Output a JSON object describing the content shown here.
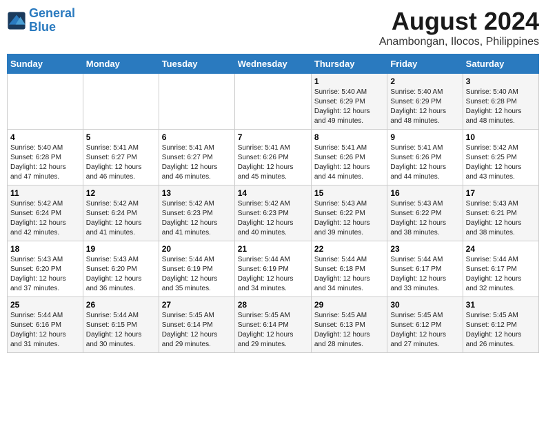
{
  "header": {
    "logo_line1": "General",
    "logo_line2": "Blue",
    "title": "August 2024",
    "subtitle": "Anambongan, Ilocos, Philippines"
  },
  "days_of_week": [
    "Sunday",
    "Monday",
    "Tuesday",
    "Wednesday",
    "Thursday",
    "Friday",
    "Saturday"
  ],
  "weeks": [
    [
      {
        "day": "",
        "info": ""
      },
      {
        "day": "",
        "info": ""
      },
      {
        "day": "",
        "info": ""
      },
      {
        "day": "",
        "info": ""
      },
      {
        "day": "1",
        "info": "Sunrise: 5:40 AM\nSunset: 6:29 PM\nDaylight: 12 hours\nand 49 minutes."
      },
      {
        "day": "2",
        "info": "Sunrise: 5:40 AM\nSunset: 6:29 PM\nDaylight: 12 hours\nand 48 minutes."
      },
      {
        "day": "3",
        "info": "Sunrise: 5:40 AM\nSunset: 6:28 PM\nDaylight: 12 hours\nand 48 minutes."
      }
    ],
    [
      {
        "day": "4",
        "info": "Sunrise: 5:40 AM\nSunset: 6:28 PM\nDaylight: 12 hours\nand 47 minutes."
      },
      {
        "day": "5",
        "info": "Sunrise: 5:41 AM\nSunset: 6:27 PM\nDaylight: 12 hours\nand 46 minutes."
      },
      {
        "day": "6",
        "info": "Sunrise: 5:41 AM\nSunset: 6:27 PM\nDaylight: 12 hours\nand 46 minutes."
      },
      {
        "day": "7",
        "info": "Sunrise: 5:41 AM\nSunset: 6:26 PM\nDaylight: 12 hours\nand 45 minutes."
      },
      {
        "day": "8",
        "info": "Sunrise: 5:41 AM\nSunset: 6:26 PM\nDaylight: 12 hours\nand 44 minutes."
      },
      {
        "day": "9",
        "info": "Sunrise: 5:41 AM\nSunset: 6:26 PM\nDaylight: 12 hours\nand 44 minutes."
      },
      {
        "day": "10",
        "info": "Sunrise: 5:42 AM\nSunset: 6:25 PM\nDaylight: 12 hours\nand 43 minutes."
      }
    ],
    [
      {
        "day": "11",
        "info": "Sunrise: 5:42 AM\nSunset: 6:24 PM\nDaylight: 12 hours\nand 42 minutes."
      },
      {
        "day": "12",
        "info": "Sunrise: 5:42 AM\nSunset: 6:24 PM\nDaylight: 12 hours\nand 41 minutes."
      },
      {
        "day": "13",
        "info": "Sunrise: 5:42 AM\nSunset: 6:23 PM\nDaylight: 12 hours\nand 41 minutes."
      },
      {
        "day": "14",
        "info": "Sunrise: 5:42 AM\nSunset: 6:23 PM\nDaylight: 12 hours\nand 40 minutes."
      },
      {
        "day": "15",
        "info": "Sunrise: 5:43 AM\nSunset: 6:22 PM\nDaylight: 12 hours\nand 39 minutes."
      },
      {
        "day": "16",
        "info": "Sunrise: 5:43 AM\nSunset: 6:22 PM\nDaylight: 12 hours\nand 38 minutes."
      },
      {
        "day": "17",
        "info": "Sunrise: 5:43 AM\nSunset: 6:21 PM\nDaylight: 12 hours\nand 38 minutes."
      }
    ],
    [
      {
        "day": "18",
        "info": "Sunrise: 5:43 AM\nSunset: 6:20 PM\nDaylight: 12 hours\nand 37 minutes."
      },
      {
        "day": "19",
        "info": "Sunrise: 5:43 AM\nSunset: 6:20 PM\nDaylight: 12 hours\nand 36 minutes."
      },
      {
        "day": "20",
        "info": "Sunrise: 5:44 AM\nSunset: 6:19 PM\nDaylight: 12 hours\nand 35 minutes."
      },
      {
        "day": "21",
        "info": "Sunrise: 5:44 AM\nSunset: 6:19 PM\nDaylight: 12 hours\nand 34 minutes."
      },
      {
        "day": "22",
        "info": "Sunrise: 5:44 AM\nSunset: 6:18 PM\nDaylight: 12 hours\nand 34 minutes."
      },
      {
        "day": "23",
        "info": "Sunrise: 5:44 AM\nSunset: 6:17 PM\nDaylight: 12 hours\nand 33 minutes."
      },
      {
        "day": "24",
        "info": "Sunrise: 5:44 AM\nSunset: 6:17 PM\nDaylight: 12 hours\nand 32 minutes."
      }
    ],
    [
      {
        "day": "25",
        "info": "Sunrise: 5:44 AM\nSunset: 6:16 PM\nDaylight: 12 hours\nand 31 minutes."
      },
      {
        "day": "26",
        "info": "Sunrise: 5:44 AM\nSunset: 6:15 PM\nDaylight: 12 hours\nand 30 minutes."
      },
      {
        "day": "27",
        "info": "Sunrise: 5:45 AM\nSunset: 6:14 PM\nDaylight: 12 hours\nand 29 minutes."
      },
      {
        "day": "28",
        "info": "Sunrise: 5:45 AM\nSunset: 6:14 PM\nDaylight: 12 hours\nand 29 minutes."
      },
      {
        "day": "29",
        "info": "Sunrise: 5:45 AM\nSunset: 6:13 PM\nDaylight: 12 hours\nand 28 minutes."
      },
      {
        "day": "30",
        "info": "Sunrise: 5:45 AM\nSunset: 6:12 PM\nDaylight: 12 hours\nand 27 minutes."
      },
      {
        "day": "31",
        "info": "Sunrise: 5:45 AM\nSunset: 6:12 PM\nDaylight: 12 hours\nand 26 minutes."
      }
    ]
  ]
}
